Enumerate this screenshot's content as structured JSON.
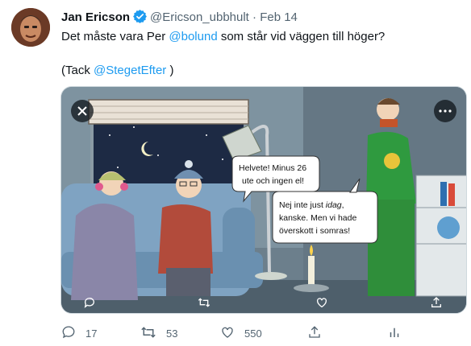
{
  "tweet": {
    "author_name": "Jan Ericson",
    "author_handle": "@Ericson_ubbhult",
    "separator": "·",
    "date": "Feb 14",
    "text_part1": "Det måste vara Per ",
    "mention1": "@bolund",
    "text_part2": " som står vid väggen till höger?",
    "line2_open": "(Tack ",
    "mention2": "@StegetEfter",
    "line2_close": " )"
  },
  "comic": {
    "bubble1_line1": "Helvete! Minus 26",
    "bubble1_line2": "ute och ingen el!",
    "bubble2_line1_a": "Nej inte just ",
    "bubble2_line1_b": "idag",
    "bubble2_line1_c": ",",
    "bubble2_line2": "kanske. Men vi hade",
    "bubble2_line3": "överskott i somras!"
  },
  "actions": {
    "reply_count": "17",
    "retweet_count": "53",
    "like_count": "550"
  },
  "colors": {
    "accent": "#1d9bf0",
    "muted": "#536471",
    "verified": "#1d9bf0"
  },
  "icons": [
    "avatar",
    "verified-badge-icon",
    "close-icon",
    "more-icon",
    "reply-icon",
    "retweet-icon",
    "like-icon",
    "share-icon",
    "analytics-icon"
  ]
}
